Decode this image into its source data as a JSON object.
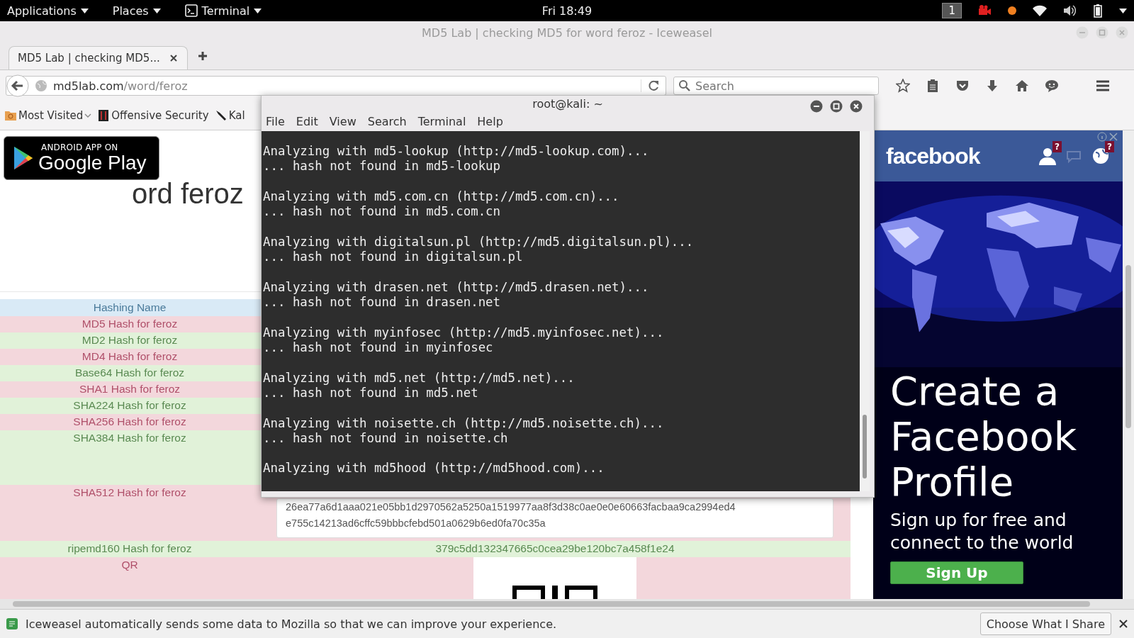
{
  "topbar": {
    "menus": [
      {
        "label": "Applications",
        "kind": "text"
      },
      {
        "label": "Places",
        "kind": "text"
      },
      {
        "label": "Terminal",
        "kind": "app"
      }
    ],
    "clock": "Fri 18:49",
    "workspace": "1"
  },
  "browser": {
    "title": "MD5 Lab | checking MD5 for word feroz - Iceweasel",
    "tabs": [
      {
        "label": "MD5 Lab | checking MD5...",
        "selected": true
      }
    ],
    "url": {
      "host": "md5lab.com",
      "path": "/word/feroz"
    },
    "search": {
      "placeholder": "Search"
    },
    "bookmarks": [
      {
        "label": "Most Visited",
        "kind": "folder"
      },
      {
        "label": "Offensive Security",
        "kind": "site"
      },
      {
        "label": "Kal",
        "kind": "tool"
      }
    ]
  },
  "page": {
    "badge": {
      "top": "ANDROID APP ON",
      "bottom": "Google Play"
    },
    "heading": "ord feroz",
    "table": {
      "columns": [
        "Hashing Name"
      ],
      "rows": [
        {
          "name": "MD5 Hash for feroz",
          "kind": "plain"
        },
        {
          "name": "MD2 Hash for feroz",
          "kind": "plain"
        },
        {
          "name": "MD4 Hash for feroz",
          "kind": "plain"
        },
        {
          "name": "Base64 Hash for feroz",
          "kind": "plain"
        },
        {
          "name": "SHA1 Hash for feroz",
          "kind": "plain"
        },
        {
          "name": "SHA224 Hash for feroz",
          "kind": "plain"
        },
        {
          "name": "SHA256 Hash for feroz",
          "kind": "plain"
        },
        {
          "name": "SHA384 Hash for feroz",
          "kind": "tall"
        },
        {
          "name": "SHA512 Hash for feroz",
          "kind": "textarea",
          "value_lines": [
            "26ea77a6d1aaa021e05bb1d2970562a5250a1519977aa8f3d38c0ae0e0e60663facbaa9ca2994ed4",
            "e755c14213ad6cffc59bbbcfebd501a0629b6ed0fa70c35a"
          ]
        },
        {
          "name": "ripemd160 Hash for feroz",
          "kind": "text",
          "value": "379c5dd132347665c0cea29be120bc7a458f1e24"
        },
        {
          "name": "QR",
          "kind": "qr"
        }
      ]
    }
  },
  "ad": {
    "brand": "facebook",
    "header_icons": [
      {
        "kind": "friends",
        "badge": "?"
      },
      {
        "kind": "messages"
      },
      {
        "kind": "globe",
        "badge": "?"
      }
    ],
    "headline": "Create a Facebook Profile",
    "subline": "Sign up for free and connect to the world",
    "button": "Sign Up"
  },
  "terminal": {
    "title": "root@kali: ~",
    "menu": [
      "File",
      "Edit",
      "View",
      "Search",
      "Terminal",
      "Help"
    ],
    "blocks": [
      {
        "cmd": "Analyzing with md5-lookup (http://md5-lookup.com)...",
        "result": "... hash not found in md5-lookup"
      },
      {
        "cmd": "Analyzing with md5.com.cn (http://md5.com.cn)...",
        "result": "... hash not found in md5.com.cn"
      },
      {
        "cmd": "Analyzing with digitalsun.pl (http://md5.digitalsun.pl)...",
        "result": "... hash not found in digitalsun.pl"
      },
      {
        "cmd": "Analyzing with drasen.net (http://md5.drasen.net)...",
        "result": "... hash not found in drasen.net"
      },
      {
        "cmd": "Analyzing with myinfosec (http://md5.myinfosec.net)...",
        "result": "... hash not found in myinfosec"
      },
      {
        "cmd": "Analyzing with md5.net (http://md5.net)...",
        "result": "... hash not found in md5.net"
      },
      {
        "cmd": "Analyzing with noisette.ch (http://md5.noisette.ch)...",
        "result": "... hash not found in noisette.ch"
      },
      {
        "cmd": "Analyzing with md5hood (http://md5hood.com)..."
      }
    ]
  },
  "notification": {
    "message": "Iceweasel automatically sends some data to Mozilla so that we can improve your experience.",
    "button": "Choose What I Share"
  }
}
